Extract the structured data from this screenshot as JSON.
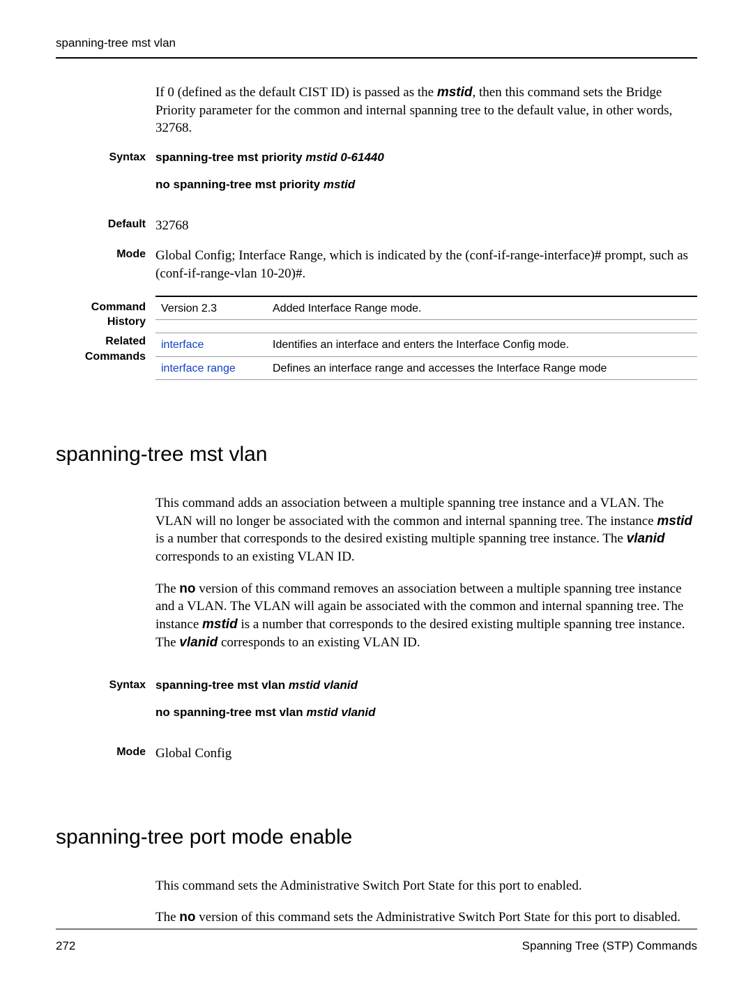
{
  "running_head": "spanning-tree mst vlan",
  "intro_para": {
    "pre": "If 0 (defined as the default CIST ID) is passed as the ",
    "arg": "mstid",
    "post": ", then this command sets the Bridge Priority parameter for the common and internal spanning tree to the default value, in other words, 32768."
  },
  "labels": {
    "syntax": "Syntax",
    "default": "Default",
    "mode": "Mode",
    "cmd_history": "Command History",
    "related": "Related Commands"
  },
  "priority": {
    "syntax1_cmd": "spanning-tree mst priority",
    "syntax1_arg": "mstid 0-61440",
    "syntax2_cmd": "no spanning-tree mst priority",
    "syntax2_arg": "mstid",
    "default": "32768",
    "mode": "Global Config; Interface Range, which is indicated by the (conf-if-range-interface)# prompt, such as (conf-if-range-vlan 10-20)#.",
    "history": {
      "c1": "Version 2.3",
      "c2": "Added Interface Range mode."
    },
    "related": [
      {
        "c1": "interface",
        "c2": "Identifies an interface and enters the Interface Config mode."
      },
      {
        "c1": "interface range",
        "c2": "Defines an interface range and accesses the Interface Range mode"
      }
    ]
  },
  "vlan": {
    "title": "spanning-tree mst vlan",
    "p1a": "This command adds an association between a multiple spanning tree instance and a VLAN. The VLAN will no longer be associated with the common and internal spanning tree. The instance ",
    "p1_m": "mstid",
    "p1b": " is a number that corresponds to the desired existing multiple spanning tree instance. The ",
    "p1_v": "vlanid",
    "p1c": " corresponds to an existing VLAN ID.",
    "p2a": "The ",
    "p2_no": "no",
    "p2b": " version of this command removes an association between a multiple spanning tree instance and a VLAN. The VLAN will again be associated with the common and internal spanning tree. The instance ",
    "p2_m": "mstid",
    "p2c": " is a number that corresponds to the desired existing multiple spanning tree instance. The ",
    "p2_v": "vlanid",
    "p2d": " corresponds to an existing VLAN ID.",
    "syntax1_cmd": "spanning-tree mst vlan",
    "syntax1_arg": "mstid vlanid",
    "syntax2_cmd": "no spanning-tree mst vlan",
    "syntax2_arg": "mstid vlanid",
    "mode": "Global Config"
  },
  "port": {
    "title": "spanning-tree port mode enable",
    "p1": "This command sets the Administrative Switch Port State for this port to enabled.",
    "p2a": "The ",
    "p2_no": "no",
    "p2b": " version of this command sets the Administrative Switch Port State for this port to disabled."
  },
  "footer": {
    "page": "272",
    "section": "Spanning Tree (STP) Commands"
  }
}
